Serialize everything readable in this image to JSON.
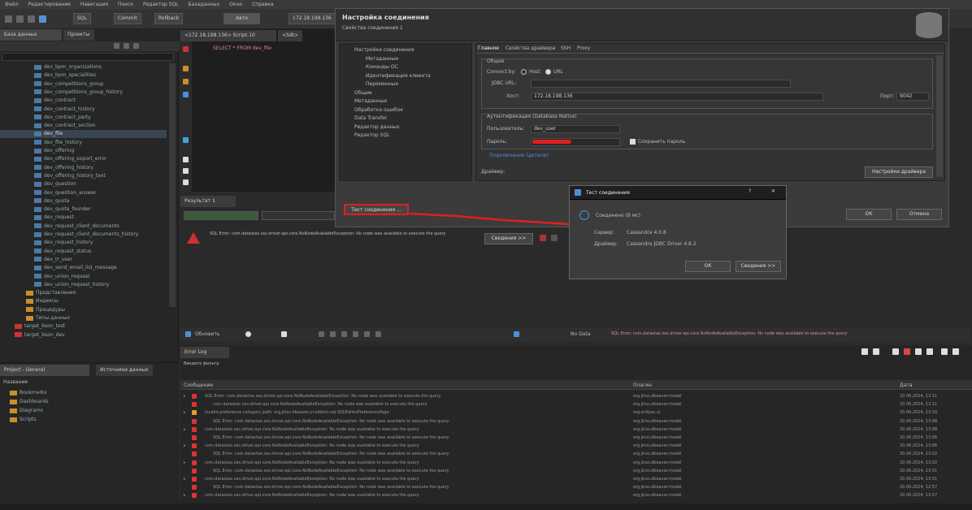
{
  "menu": [
    "Файл",
    "Редактирование",
    "Навигация",
    "Поиск",
    "Редактор SQL",
    "Базаданных",
    "Окно",
    "Справка"
  ],
  "toolbar": {
    "sql_label": "SQL",
    "commit_label": "Commit",
    "rollback_label": "Rollback",
    "mode_label": "Авто",
    "conn_label": "172.18.198.136"
  },
  "left": {
    "tab_db": "База данных",
    "tab_projects": "Проекты",
    "items": [
      {
        "label": "dev_bpm_organizations",
        "type": "table"
      },
      {
        "label": "dev_bpm_specialities",
        "type": "table"
      },
      {
        "label": "dev_competitions_group",
        "type": "table"
      },
      {
        "label": "dev_competitions_group_history",
        "type": "table"
      },
      {
        "label": "dev_contract",
        "type": "table"
      },
      {
        "label": "dev_contract_history",
        "type": "table"
      },
      {
        "label": "dev_contract_party",
        "type": "table"
      },
      {
        "label": "dev_contract_section",
        "type": "table"
      },
      {
        "label": "dev_file",
        "type": "table",
        "selected": true
      },
      {
        "label": "dev_file_history",
        "type": "table"
      },
      {
        "label": "dev_offering",
        "type": "table"
      },
      {
        "label": "dev_offering_export_error",
        "type": "table"
      },
      {
        "label": "dev_offering_history",
        "type": "table"
      },
      {
        "label": "dev_offering_history_text",
        "type": "table"
      },
      {
        "label": "dev_question",
        "type": "table"
      },
      {
        "label": "dev_question_answer",
        "type": "table"
      },
      {
        "label": "dev_quota",
        "type": "table"
      },
      {
        "label": "dev_quota_founder",
        "type": "table"
      },
      {
        "label": "dev_request",
        "type": "table"
      },
      {
        "label": "dev_request_client_documents",
        "type": "table"
      },
      {
        "label": "dev_request_client_documents_history",
        "type": "table"
      },
      {
        "label": "dev_request_history",
        "type": "table"
      },
      {
        "label": "dev_request_status",
        "type": "table"
      },
      {
        "label": "dev_tr_user",
        "type": "table"
      },
      {
        "label": "dev_send_email_list_message",
        "type": "table"
      },
      {
        "label": "dev_union_request",
        "type": "table"
      },
      {
        "label": "dev_union_request_history",
        "type": "table"
      },
      {
        "label": "Представления",
        "type": "folder"
      },
      {
        "label": "Индексы",
        "type": "folder"
      },
      {
        "label": "Процедуры",
        "type": "folder"
      },
      {
        "label": "Типы данных",
        "type": "folder"
      },
      {
        "label": "target_bson_test",
        "type": "db"
      },
      {
        "label": "target_bson_dev",
        "type": "db"
      }
    ]
  },
  "project": {
    "tab": "Project - General",
    "tab2": "Источники данных",
    "col": "Название",
    "items": [
      "Bookmarks",
      "Dashboards",
      "Diagrams",
      "Scripts"
    ]
  },
  "editor": {
    "tab1": "<172.18.198.136> Script-10",
    "tab2": "<Sdt>",
    "sql": "SELECT * FROM dev_file"
  },
  "results": {
    "tab": "Результат 1",
    "error": "SQL Error: com.datastax.oss.driver.api.core.NoNodeAvailableException: No node was available to execute the query",
    "status_left": "Обновить",
    "status_err": "SQL Error: com.datastax.oss.driver.api.core.NoNodeAvailableException: No node was available to execute the query",
    "btn_more": "Сведения >>",
    "no_data": "No Data"
  },
  "dialog": {
    "title": "Настройка соединения",
    "subtitle": "Свойства соединения 1",
    "nav": [
      "Настройки соединения",
      "Метаданные",
      "Команды ОС",
      "Идентификация клиента",
      "Переменные",
      "Общие",
      "Метаданные",
      "Обработка ошибок",
      "Data Transfer",
      "Редактор данных",
      "Редактор SQL"
    ],
    "tabs": [
      "Главное",
      "Свойства драйвера",
      "SSH",
      "Proxy"
    ],
    "group_general": "Общее",
    "connect_by": "Connect by:",
    "opt_host": "Host",
    "opt_url": "URL",
    "jdbc_label": "JDBC URL:",
    "host_label": "Хост:",
    "host_value": "172.18.198.136",
    "port_label": "Порт:",
    "port_value": "9042",
    "group_auth": "Аутентификация (Database Native)",
    "user_label": "Пользователь:",
    "user_value": "dev_user",
    "pass_label": "Пароль:",
    "save_pass": "Сохранить пароль",
    "connection_details": "Подключение (детали)",
    "driver_label": "Драйвер:",
    "driver_settings": "Настройки драйвера",
    "test_btn": "Тест соединения ...",
    "ok_btn": "ОК",
    "cancel_btn": "Отмена"
  },
  "popup": {
    "title": "Тест соединения",
    "status": "Соединено (8 мс)",
    "server_label": "Сервер:",
    "server_value": "Cassandra 4.0.8",
    "driver_label": "Драйвер:",
    "driver_value": "Cassandra JDBC Driver 4.8.2",
    "ok_btn": "ОК",
    "details_btn": "Сведения >>"
  },
  "errorlog": {
    "tab": "Error Log",
    "filter": "Введите фильтр",
    "cols": [
      "Сообщение",
      "Плагин",
      "Дата"
    ],
    "rows": [
      {
        "msg": "SQL Error: com.datastax.oss.driver.api.core.NoNodeAvailableException: No node was available to execute the query",
        "plugin": "org.jkiss.dbeaver.model",
        "date": "20.06.2024, 13:11"
      },
      {
        "msg": "com.datastax.oss.driver.api.core.NoNodeAvailableException: No node was available to execute the query",
        "plugin": "org.jkiss.dbeaver.model",
        "date": "20.06.2024, 13:11"
      },
      {
        "msg": "Invalid preference category path: org.jkiss.dbeaver.ui.editors.sql.SQLEditorPreferencePage",
        "plugin": "org.eclipse.ui",
        "date": "20.06.2024, 13:10"
      },
      {
        "msg": "SQL Error: com.datastax.oss.driver.api.core.NoNodeAvailableException: No node was available to execute the query",
        "plugin": "org.jkiss.dbeaver.model",
        "date": "20.06.2024, 13:08"
      },
      {
        "msg": "com.datastax.oss.driver.api.core.NoNodeAvailableException: No node was available to execute the query",
        "plugin": "org.jkiss.dbeaver.model",
        "date": "20.06.2024, 13:08"
      },
      {
        "msg": "SQL Error: com.datastax.oss.driver.api.core.NoNodeAvailableException: No node was available to execute the query",
        "plugin": "org.jkiss.dbeaver.model",
        "date": "20.06.2024, 13:06"
      },
      {
        "msg": "com.datastax.oss.driver.api.core.NoNodeAvailableException: No node was available to execute the query",
        "plugin": "org.jkiss.dbeaver.model",
        "date": "20.06.2024, 13:06"
      },
      {
        "msg": "SQL Error: com.datastax.oss.driver.api.core.NoNodeAvailableException: No node was available to execute the query",
        "plugin": "org.jkiss.dbeaver.model",
        "date": "20.06.2024, 13:02"
      },
      {
        "msg": "com.datastax.oss.driver.api.core.NoNodeAvailableException: No node was available to execute the query",
        "plugin": "org.jkiss.dbeaver.model",
        "date": "20.06.2024, 13:02"
      },
      {
        "msg": "SQL Error: com.datastax.oss.driver.api.core.NoNodeAvailableException: No node was available to execute the query",
        "plugin": "org.jkiss.dbeaver.model",
        "date": "20.06.2024, 13:01"
      },
      {
        "msg": "com.datastax.oss.driver.api.core.NoNodeAvailableException: No node was available to execute the query",
        "plugin": "org.jkiss.dbeaver.model",
        "date": "20.06.2024, 13:01"
      },
      {
        "msg": "SQL Error: com.datastax.oss.driver.api.core.NoNodeAvailableException: No node was available to execute the query",
        "plugin": "org.jkiss.dbeaver.model",
        "date": "20.06.2024, 12:57"
      },
      {
        "msg": "com.datastax.oss.driver.api.core.NoNodeAvailableException: No node was available to execute the query",
        "plugin": "org.jkiss.dbeaver.model",
        "date": "20.06.2024, 12:57"
      }
    ]
  },
  "colors": {
    "accent": "#e02020",
    "bg": "#2b2b2b",
    "selection": "#3a4550",
    "popup_header": "#1f1f1f"
  }
}
